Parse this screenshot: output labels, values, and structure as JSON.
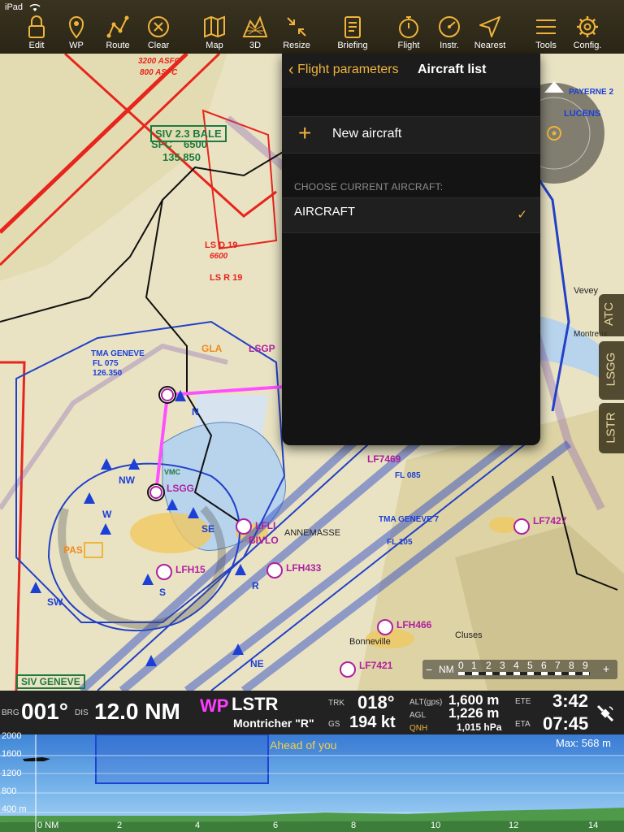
{
  "status_bar": {
    "device": "iPad"
  },
  "toolbar": {
    "items": [
      {
        "label": "Edit",
        "icon": "lock-icon"
      },
      {
        "label": "WP",
        "icon": "pin-icon"
      },
      {
        "label": "Route",
        "icon": "route-icon"
      },
      {
        "label": "Clear",
        "icon": "clear-icon"
      },
      {
        "label": "Map",
        "icon": "map-icon"
      },
      {
        "label": "3D",
        "icon": "terrain-3d-icon"
      },
      {
        "label": "Resize",
        "icon": "resize-icon"
      },
      {
        "label": "Briefing",
        "icon": "briefing-icon"
      },
      {
        "label": "Flight",
        "icon": "stopwatch-icon"
      },
      {
        "label": "Instr.",
        "icon": "gauge-icon"
      },
      {
        "label": "Nearest",
        "icon": "nearest-icon"
      },
      {
        "label": "Tools",
        "icon": "menu-icon"
      },
      {
        "label": "Config.",
        "icon": "gear-icon"
      }
    ]
  },
  "popover": {
    "back_label": "Flight parameters",
    "title": "Aircraft list",
    "new_aircraft": "New aircraft",
    "section_header": "CHOOSE CURRENT AIRCRAFT:",
    "aircraft": [
      {
        "name": "AIRCRAFT",
        "selected": true
      }
    ]
  },
  "side_tabs": [
    "ATC",
    "LSGG",
    "LSTR"
  ],
  "map_labels": {
    "siv_bale": "SIV 2.3 BALE",
    "sfc": "SFC",
    "alt1": "6500",
    "freq1": "135.850",
    "tma_geneve": "TMA GENEVE",
    "fl075": "FL 075",
    "freq_tma": "126.350",
    "lsgp": "LSGP",
    "gla": "GLA",
    "lsgg": "LSGG",
    "lfli": "LFLI",
    "bivlo": "BIVLO",
    "lfh15": "LFH15",
    "lfh433": "LFH433",
    "lfh466": "LFH466",
    "lf7469": "LF7469",
    "lf7427": "LF7427",
    "lf7421": "LF7421",
    "pas": "PAS",
    "ne": "NE",
    "se": "SE",
    "sw": "SW",
    "nw": "NW",
    "w": "W",
    "n": "N",
    "s": "S",
    "r": "R",
    "ls_d19": "LS D 19",
    "ls_r19": "LS R 19",
    "alt_6600": "6600",
    "asfc": "3200 ASFC",
    "asfc2": "800 ASFC",
    "payerne": "PAYERNE 2",
    "lucens": "LUCENS",
    "annemasse": "ANNEMASSE",
    "vevey": "Vevey",
    "cluses": "Cluses",
    "montreux": "Montreux",
    "bonneville": "Bonneville",
    "tma_geneve7": "TMA GENEVE 7",
    "fl105": "FL 105",
    "fl085": "FL 085",
    "siv_geneve": "SIV GENEVE",
    "vmc": "VMC"
  },
  "scale_bar": {
    "unit": "NM",
    "ticks": [
      "0",
      "1",
      "2",
      "3",
      "4",
      "5",
      "6",
      "7",
      "8",
      "9"
    ],
    "minus": "−",
    "plus": "+"
  },
  "info_bar": {
    "brg_label": "BRG",
    "brg_value": "001°",
    "dis_label": "DIS",
    "dis_value": "12.0 NM",
    "wp_label": "WP",
    "wp_code": "LSTR",
    "wp_name": "Montricher \"R\"",
    "trk_label": "TRK",
    "trk_value": "018°",
    "gs_label": "GS",
    "gs_value": "194 kt",
    "alt_label": "ALT(gps)",
    "alt_value": "1,600 m",
    "agl_label": "AGL",
    "agl_value": "1,226 m",
    "qnh_label": "QNH",
    "qnh_value": "1,015 hPa",
    "ete_label": "ETE",
    "ete_value": "3:42",
    "eta_label": "ETA",
    "eta_value": "07:45"
  },
  "profile": {
    "ahead_label": "Ahead of you",
    "max_label": "Max: 568 m",
    "y_ticks": [
      "2000",
      "1600",
      "1200",
      "800",
      "400 m"
    ],
    "x_ticks": [
      "0 NM",
      "2",
      "4",
      "6",
      "8",
      "10",
      "12",
      "14"
    ]
  }
}
